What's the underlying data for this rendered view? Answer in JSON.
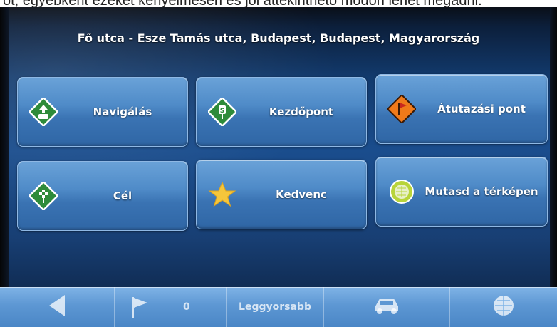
{
  "header": {
    "address": "Fő utca - Esze Tamás utca, Budapest, Budapest, Magyarország"
  },
  "buttons": [
    {
      "label": "Navigálás",
      "icon": "navigate-icon"
    },
    {
      "label": "Kezdőpont",
      "icon": "start-point-icon"
    },
    {
      "label": "Átutazási pont",
      "icon": "waypoint-flag-icon"
    },
    {
      "label": "Cél",
      "icon": "destination-icon"
    },
    {
      "label": "Kedvenc",
      "icon": "star-icon"
    },
    {
      "label": "Mutasd a térképen",
      "icon": "globe-icon"
    }
  ],
  "toolbar": {
    "count": "0",
    "route_mode": "Leggyorsabb",
    "icons": [
      "back-arrow-icon",
      "flag-icon",
      "car-icon",
      "globe-icon"
    ]
  },
  "colors": {
    "button_top": "#6aa2d8",
    "button_bottom": "#2f66a5",
    "background": "#1a4d8d",
    "toolbar": "#5d97d3",
    "green_icon": "#2e8b3a",
    "orange_icon": "#f07a1a",
    "star": "#f5c63b"
  }
}
